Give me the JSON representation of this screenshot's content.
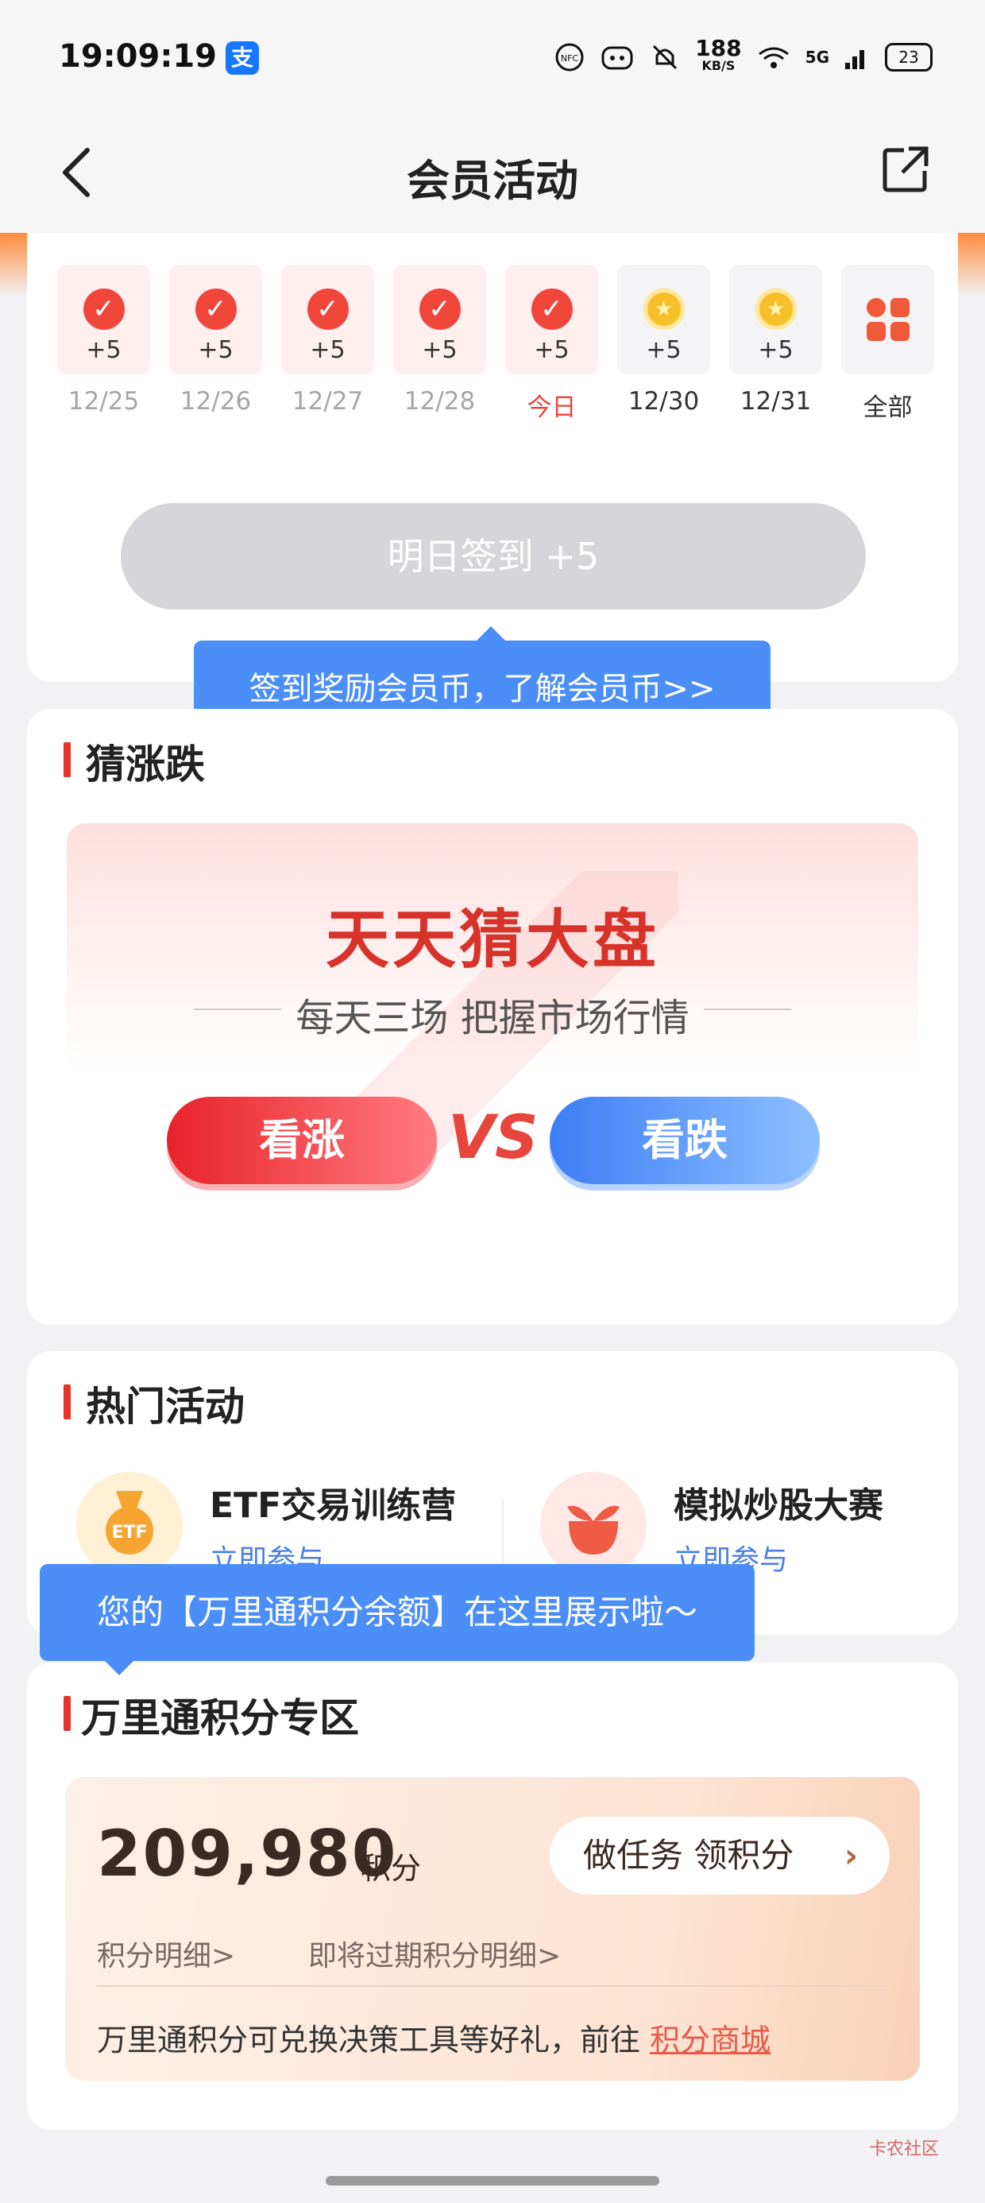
{
  "status_bar": {
    "time": "19:09:19",
    "alipay_badge": "支",
    "net_speed_value": "188",
    "net_speed_unit": "KB/S",
    "network": "5G",
    "battery": "23"
  },
  "nav": {
    "title": "会员活动"
  },
  "checkin": {
    "days": [
      {
        "points": "+5",
        "date": "12/25",
        "state": "done"
      },
      {
        "points": "+5",
        "date": "12/26",
        "state": "done"
      },
      {
        "points": "+5",
        "date": "12/27",
        "state": "done"
      },
      {
        "points": "+5",
        "date": "12/28",
        "state": "done"
      },
      {
        "points": "+5",
        "date": "今日",
        "state": "done-today"
      },
      {
        "points": "+5",
        "date": "12/30",
        "state": "future"
      },
      {
        "points": "+5",
        "date": "12/31",
        "state": "future"
      }
    ],
    "all_label": "全部",
    "button_label": "明日签到 +5",
    "tooltip": "签到奖励会员币，了解会员币>>"
  },
  "guess": {
    "section_title": "猜涨跌",
    "banner_title": "天天猜大盘",
    "banner_subtitle": "每天三场 把握市场行情",
    "up_label": "看涨",
    "vs_label": "VS",
    "down_label": "看跌"
  },
  "hot": {
    "section_title": "热门活动",
    "items": [
      {
        "name": "ETF交易训练营",
        "action": "立即参与",
        "icon_text": "ETF"
      },
      {
        "name": "模拟炒股大赛",
        "action": "立即参与"
      }
    ],
    "tooltip": "您的【万里通积分余额】在这里展示啦～"
  },
  "points": {
    "section_title": "万里通积分专区",
    "value": "209,980",
    "unit": "积分",
    "task_button": "做任务 领积分",
    "detail_link": "积分明细>",
    "expiring_link": "即将过期积分明细>",
    "note": "万里通积分可兑换决策工具等好礼，前往",
    "mall_link": "积分商城"
  },
  "watermark": "卡农社区",
  "colors": {
    "accent_red": "#e6332a",
    "tooltip_blue": "#4b8ef8",
    "button_gray": "#d6d6da"
  }
}
